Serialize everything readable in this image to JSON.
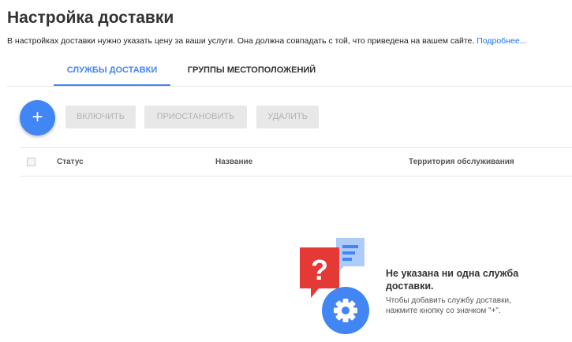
{
  "page": {
    "title": "Настройка доставки",
    "intro_text": "В настройках доставки нужно указать цену за ваши услуги. Она должна совпадать с той, что приведена на вашем сайте.",
    "intro_link": "Подробнее..."
  },
  "tabs": [
    {
      "label": "СЛУЖБЫ ДОСТАВКИ",
      "active": true
    },
    {
      "label": "ГРУППЫ МЕСТОПОЛОЖЕНИЙ",
      "active": false
    }
  ],
  "toolbar": {
    "add_label": "+",
    "enable_label": "ВКЛЮЧИТЬ",
    "pause_label": "ПРИОСТАНОВИТЬ",
    "delete_label": "УДАЛИТЬ"
  },
  "table": {
    "columns": [
      "Статус",
      "Название",
      "Территория обслуживания"
    ]
  },
  "empty_state": {
    "title": "Не указана ни одна служба доставки.",
    "hint": "Чтобы добавить службу доставки, нажмите кнопку со значком \"+\"."
  },
  "colors": {
    "accent": "#4285f4",
    "question_red": "#e53935",
    "doc_blue": "#aecbfa",
    "disabled_button_bg": "#e8e8e8"
  },
  "icons": {
    "fab": "plus-icon",
    "illustration": [
      "question-icon",
      "document-lines-icon",
      "gear-icon"
    ]
  }
}
